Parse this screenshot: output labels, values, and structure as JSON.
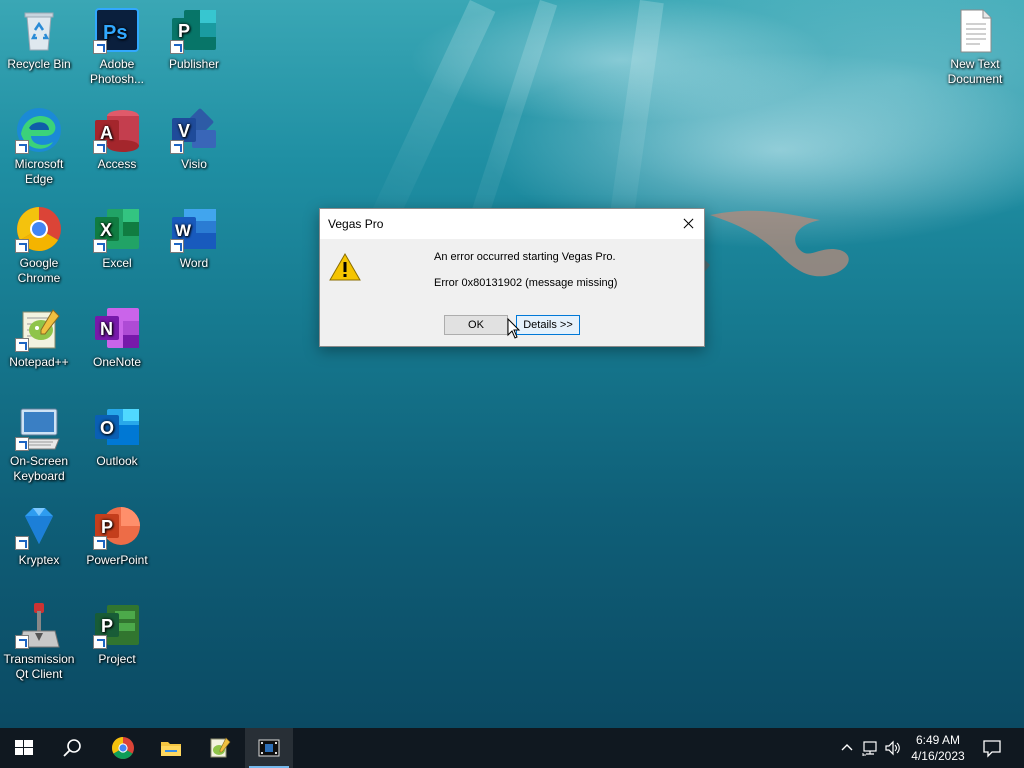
{
  "desktop": {
    "icons": [
      {
        "label": "Recycle Bin"
      },
      {
        "label": "Adobe Photosh..."
      },
      {
        "label": "Publisher"
      },
      {
        "label": "Microsoft Edge"
      },
      {
        "label": "Access"
      },
      {
        "label": "Visio"
      },
      {
        "label": "Google Chrome"
      },
      {
        "label": "Excel"
      },
      {
        "label": "Word"
      },
      {
        "label": "Notepad++"
      },
      {
        "label": "OneNote"
      },
      {
        "label": "On-Screen Keyboard"
      },
      {
        "label": "Outlook"
      },
      {
        "label": "Kryptex"
      },
      {
        "label": "PowerPoint"
      },
      {
        "label": "Transmission Qt Client"
      },
      {
        "label": "Project"
      },
      {
        "label": "New Text Document"
      }
    ]
  },
  "dialog": {
    "title": "Vegas Pro",
    "message": "An error occurred starting Vegas Pro.",
    "error": "Error 0x80131902 (message missing)",
    "ok_label": "OK",
    "details_label": "Details >>"
  },
  "taskbar": {
    "time": "6:49 AM",
    "date": "4/16/2023",
    "pinned": [
      "start-icon",
      "search-icon",
      "chrome-icon",
      "file-explorer-icon",
      "notepad-plus-plus-icon",
      "vegas-pro-icon"
    ]
  },
  "colors": {
    "accent": "#0078d7",
    "taskbar": "#101820",
    "warning": "#f5c400"
  }
}
